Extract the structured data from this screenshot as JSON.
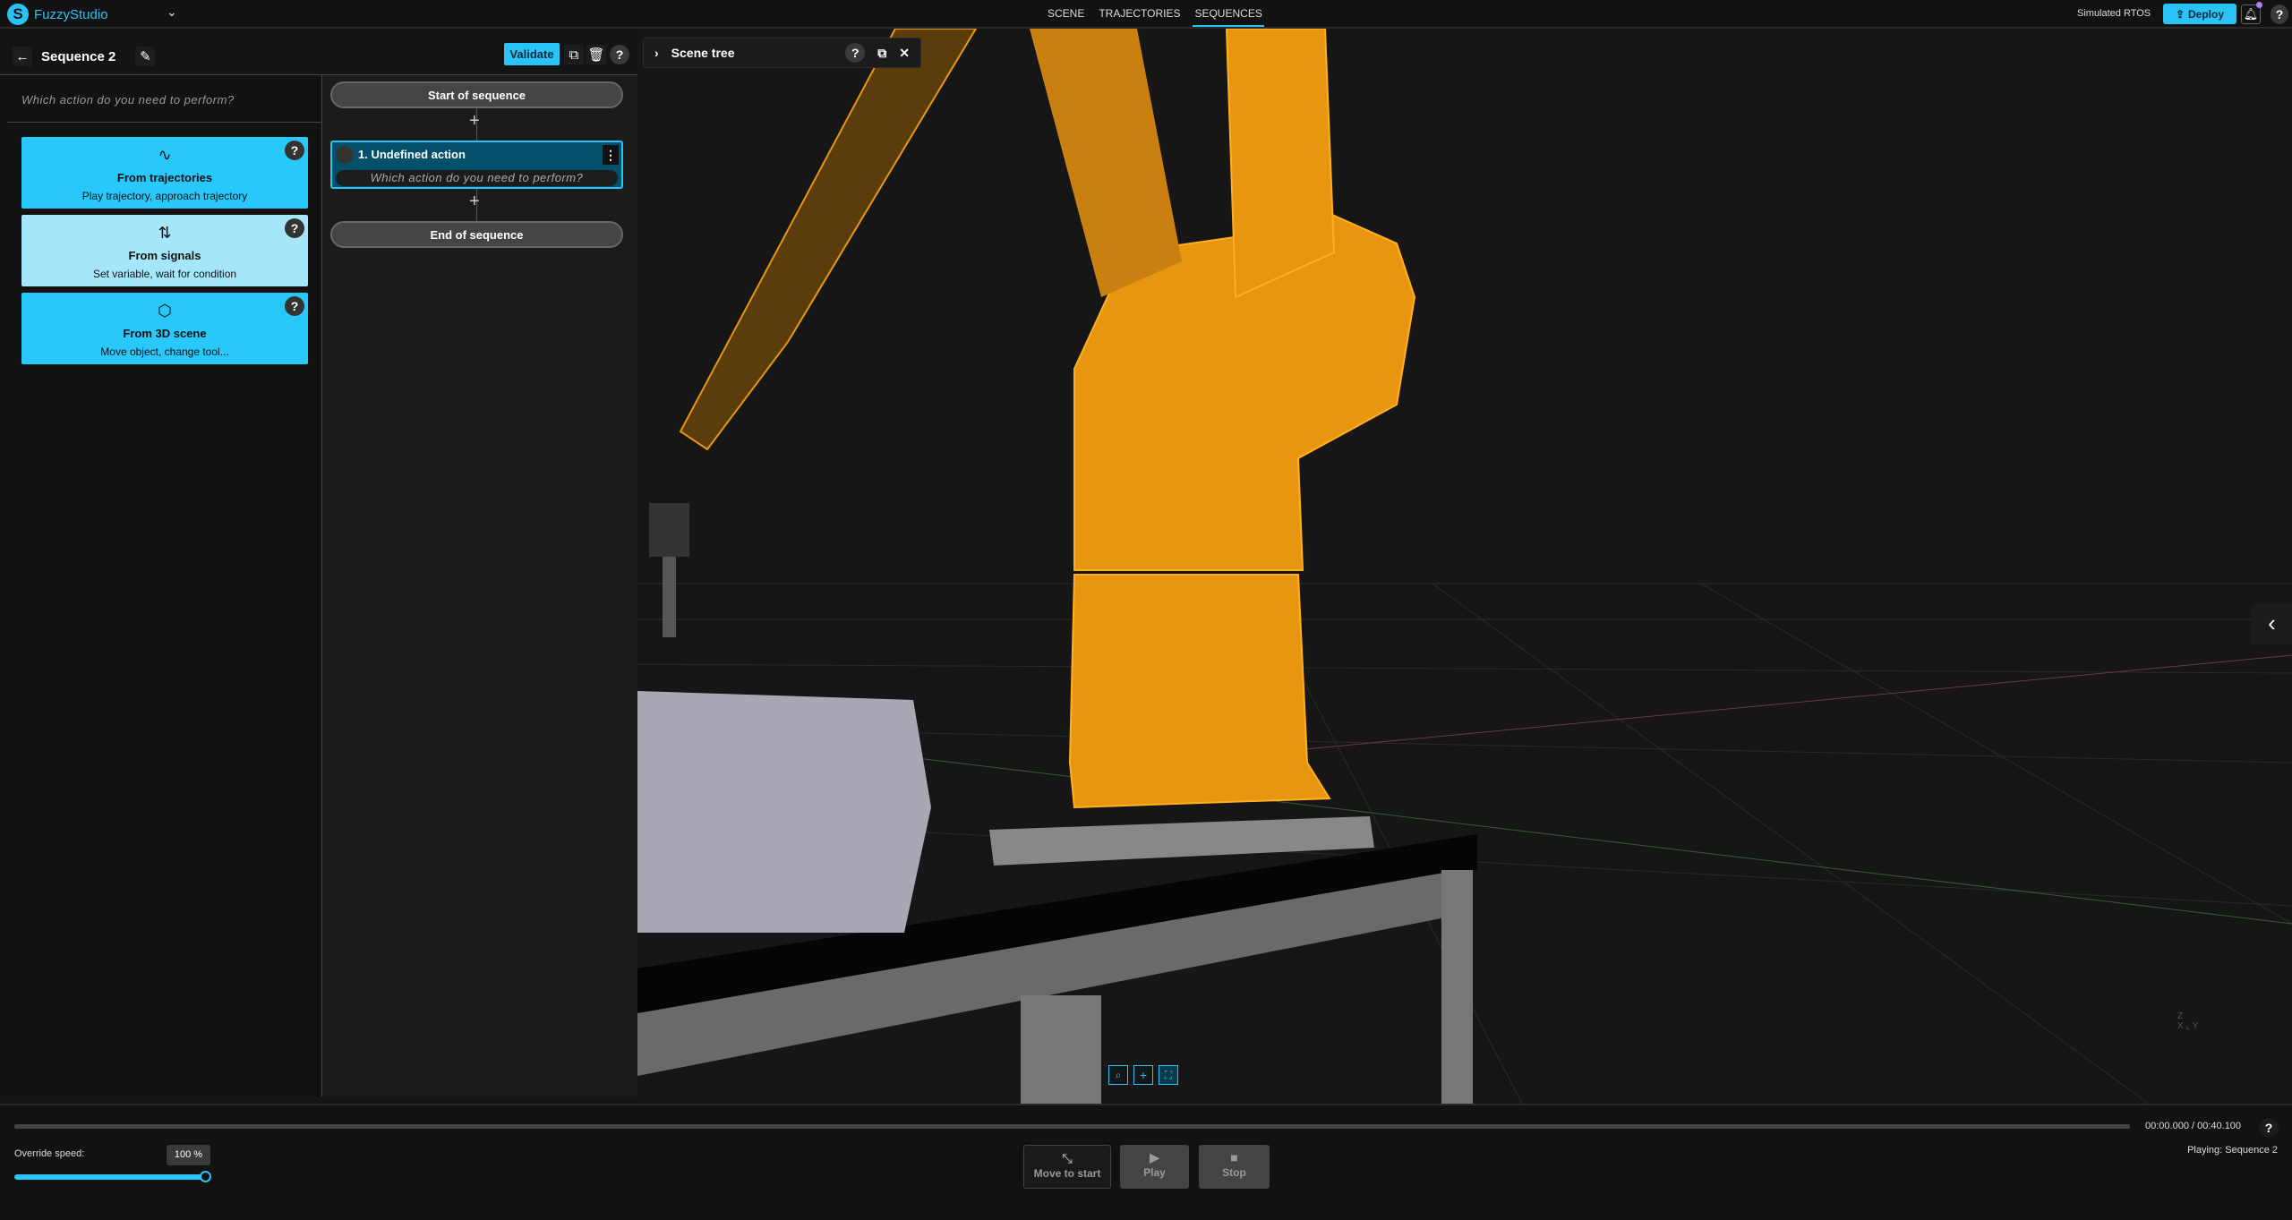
{
  "app": {
    "name": "FuzzyStudio",
    "logo_letter": "S"
  },
  "nav": {
    "tabs": [
      {
        "label": "SCENE"
      },
      {
        "label": "TRAJECTORIES"
      },
      {
        "label": "SEQUENCES",
        "active": true
      }
    ]
  },
  "topright": {
    "runtime": "Simulated RTOS",
    "deploy_label": "Deploy",
    "help": "?"
  },
  "sequence": {
    "title": "Sequence 2",
    "validate_label": "Validate",
    "help": "?"
  },
  "actions_panel": {
    "prompt": "Which action do you need to perform?",
    "cards": [
      {
        "title": "From trajectories",
        "subtitle": "Play trajectory, approach trajectory",
        "icon": "trajectory-icon",
        "help": "?"
      },
      {
        "title": "From signals",
        "subtitle": "Set variable, wait for condition",
        "icon": "signals-icon",
        "help": "?"
      },
      {
        "title": "From 3D scene",
        "subtitle": "Move object, change tool...",
        "icon": "cube-icon",
        "help": "?"
      }
    ]
  },
  "flow": {
    "start_label": "Start of sequence",
    "end_label": "End of sequence",
    "add": "+",
    "steps": [
      {
        "label": "1. Undefined action",
        "prompt": "Which action do you need to perform?"
      }
    ]
  },
  "scene_tree": {
    "title": "Scene tree",
    "help": "?"
  },
  "playback": {
    "time": "00:00.000 / 00:40.100",
    "status": "Playing: Sequence 2",
    "progress": 0,
    "override_label": "Override speed:",
    "speed_value": "100 %",
    "speed_percent": 100,
    "move_to_start": "Move to start",
    "play": "Play",
    "stop": "Stop",
    "help": "?"
  },
  "colors": {
    "accent": "#29c4f5",
    "robot": "#e8960f",
    "background": "#111111"
  }
}
